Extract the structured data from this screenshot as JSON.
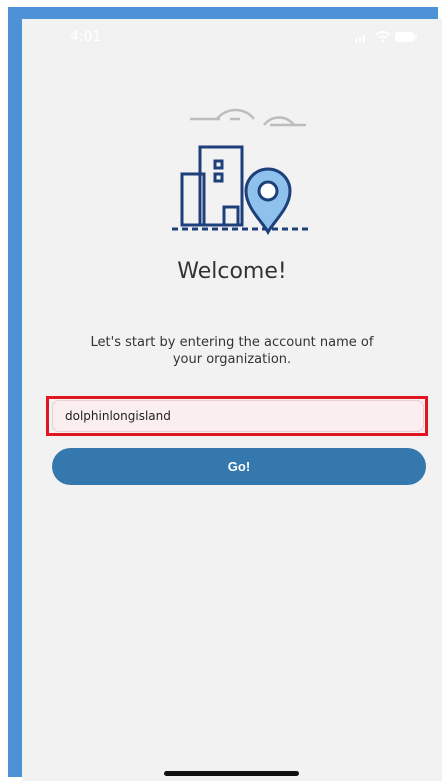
{
  "status_bar": {
    "time": "4:01",
    "icons": [
      "signal-icon",
      "wifi-icon",
      "battery-icon"
    ]
  },
  "header": {
    "illustration_icon": "building-location-pin-icon",
    "title": "Welcome!"
  },
  "form": {
    "instruction": "Let's start by entering the account name of your organization.",
    "account_name_value": "dolphinlongisland",
    "submit_label": "Go!"
  },
  "colors": {
    "background": "#f2f2f2",
    "accent": "#3478ad",
    "highlight": "#e1161f",
    "frame": "#4f91d6"
  }
}
